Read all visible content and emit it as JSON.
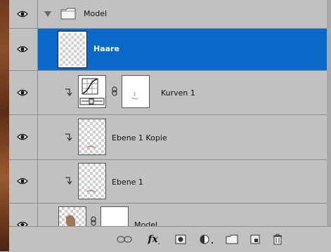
{
  "layers": {
    "group": {
      "name": "Model"
    },
    "haare": {
      "name": "Haare"
    },
    "kurven": {
      "name": "Kurven 1"
    },
    "ebene_kopie": {
      "name": "Ebene 1 Kopie"
    },
    "ebene": {
      "name": "Ebene 1"
    },
    "model": {
      "name": "Model"
    }
  },
  "toolbar": {
    "fx_label": "fx"
  },
  "colors": {
    "selection": "#0a68c8",
    "panel": "#c1c1c1"
  }
}
